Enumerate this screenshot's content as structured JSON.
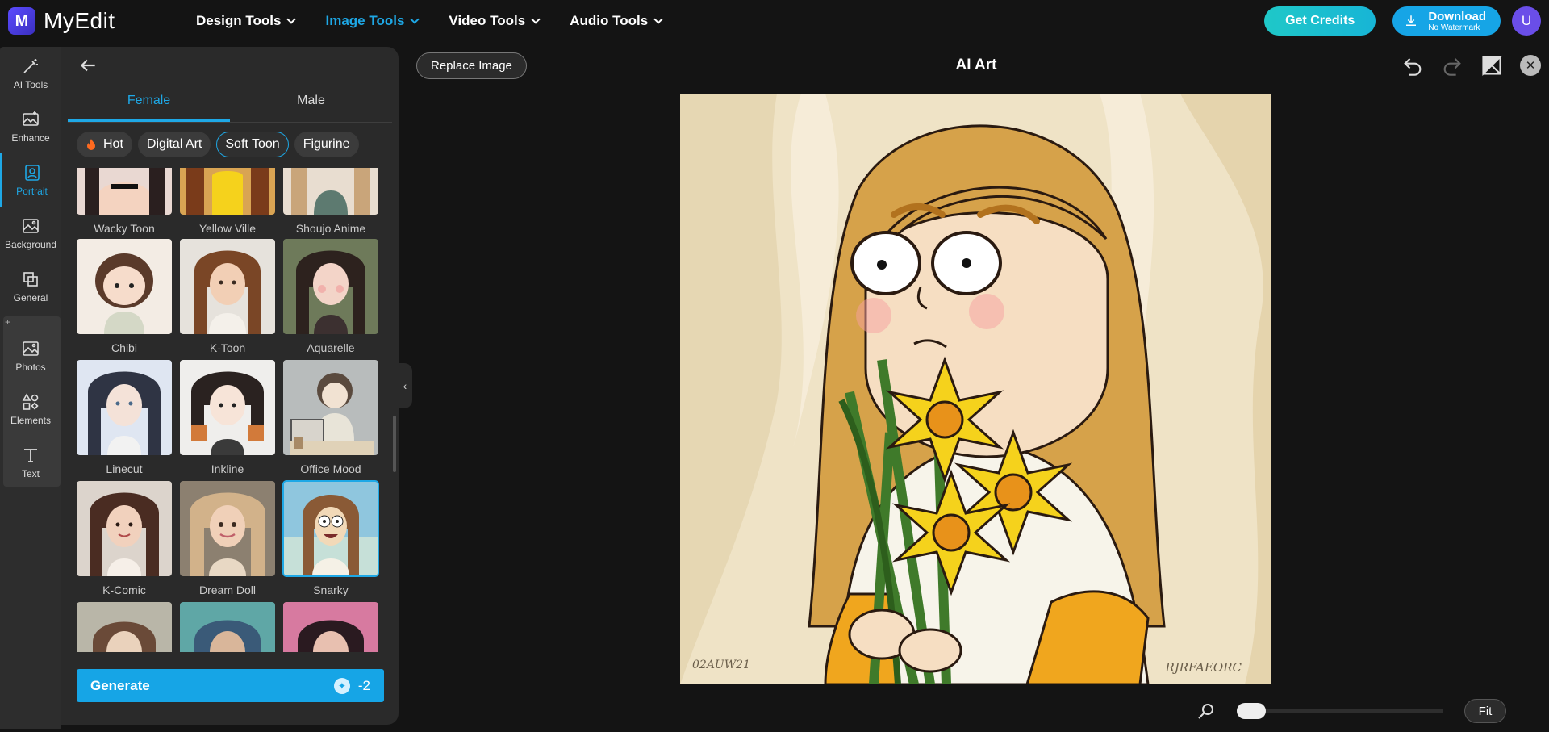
{
  "brand": {
    "name": "MyEdit",
    "mark": "M"
  },
  "nav": [
    {
      "label": "Design Tools",
      "active": false
    },
    {
      "label": "Image Tools",
      "active": true
    },
    {
      "label": "Video Tools",
      "active": false
    },
    {
      "label": "Audio Tools",
      "active": false
    }
  ],
  "header": {
    "credits_label": "Get Credits",
    "download_label": "Download",
    "download_sub": "No Watermark",
    "avatar_initial": "U"
  },
  "rail": [
    {
      "label": "AI Tools",
      "icon": "wand-icon"
    },
    {
      "label": "Enhance",
      "icon": "enhance-icon"
    },
    {
      "label": "Portrait",
      "icon": "portrait-icon"
    },
    {
      "label": "Background",
      "icon": "background-icon"
    },
    {
      "label": "General",
      "icon": "general-icon"
    },
    {
      "label": "Photos",
      "icon": "photos-icon"
    },
    {
      "label": "Elements",
      "icon": "elements-icon"
    },
    {
      "label": "Text",
      "icon": "text-icon"
    }
  ],
  "panel": {
    "tabs": [
      "Female",
      "Male"
    ],
    "active_tab": "Female",
    "chips": [
      "Hot",
      "Digital Art",
      "Soft Toon",
      "Figurine"
    ],
    "active_chip": "Soft Toon",
    "styles": [
      "Wacky Toon",
      "Yellow Ville",
      "Shoujo Anime",
      "Chibi",
      "K-Toon",
      "Aquarelle",
      "Linecut",
      "Inkline",
      "Office Mood",
      "K-Comic",
      "Dream Doll",
      "Snarky",
      "",
      "",
      ""
    ],
    "selected_style": "Snarky",
    "generate_label": "Generate",
    "generate_cost": "-2"
  },
  "canvas": {
    "replace_label": "Replace Image",
    "title": "AI Art",
    "signature_left": "02AUW21",
    "signature_right": "RJRFAEORC",
    "fit_label": "Fit",
    "zoom_fraction": 0.0
  },
  "colors": {
    "accent": "#1ea8e6",
    "credits": "#1fc8c8",
    "avatar": "#6a4ee8",
    "panel": "#2a2a2a",
    "background": "#141414"
  }
}
